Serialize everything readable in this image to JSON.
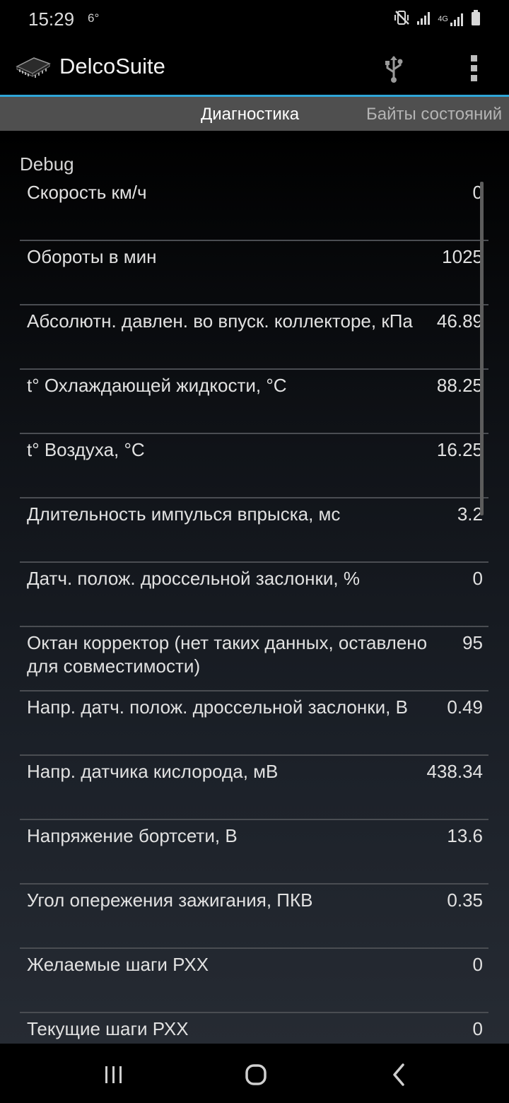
{
  "status_bar": {
    "time": "15:29",
    "notification": "6°",
    "icons": [
      "mute-vibrate-icon",
      "signal-icon",
      "4g-signal-icon",
      "battery-icon"
    ],
    "network_label": "4G"
  },
  "app_bar": {
    "title": "DelcoSuite",
    "actions": [
      "usb-icon",
      "more-vert-icon"
    ],
    "accent_color": "#2fa6d8"
  },
  "tabs": [
    {
      "label": "Диагностика",
      "active": true
    },
    {
      "label": "Байты состояний",
      "active": false
    }
  ],
  "section_title": "Debug",
  "rows": [
    {
      "label": "Скорость км/ч",
      "value": "0"
    },
    {
      "label": "Обороты в мин",
      "value": "1025"
    },
    {
      "label": "Абсолютн. давлен. во впуск. коллекторе, кПа",
      "value": "46.89"
    },
    {
      "label": "t° Охлаждающей жидкости, °C",
      "value": "88.25"
    },
    {
      "label": "t° Воздуха, °C",
      "value": "16.25"
    },
    {
      "label": "Длительность импулься впрыска, мс",
      "value": "3.2"
    },
    {
      "label": "Датч. полож. дроссельной заслонки, %",
      "value": "0"
    },
    {
      "label": "Октан корректор (нет таких данных, оставлено для совместимости)",
      "value": "95"
    },
    {
      "label": "Напр. датч. полож. дроссельной заслонки, В",
      "value": "0.49"
    },
    {
      "label": "Напр. датчика кислорода, мВ",
      "value": "438.34"
    },
    {
      "label": "Напряжение бортсети, В",
      "value": "13.6"
    },
    {
      "label": "Угол опережения зажигания, ПКВ",
      "value": "0.35"
    },
    {
      "label": "Желаемые шаги РХХ",
      "value": "0"
    },
    {
      "label": "Текущие шаги РХХ",
      "value": "0"
    }
  ],
  "nav_bar": {
    "buttons": [
      "recent-apps-icon",
      "home-icon",
      "back-icon"
    ]
  }
}
